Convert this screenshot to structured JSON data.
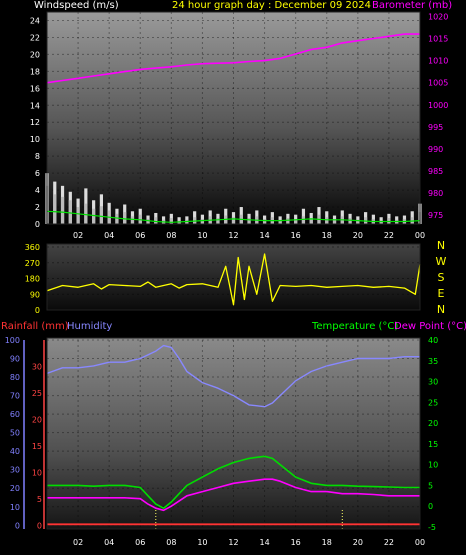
{
  "header": {
    "left_label": "Windspeed (m/s)",
    "title": "24 hour graph day : December 09 2024",
    "right_label": "Barometer (mb)"
  },
  "panel3_header": {
    "rain_label": "Rainfall (mm)",
    "humidity_label": "Humidity",
    "temp_label": "Temperature (°C)",
    "dew_label": "Dew Point (°C)"
  },
  "compass": [
    "N",
    "W",
    "S",
    "E",
    "N"
  ],
  "colors": {
    "wind": "#e0e0e0",
    "gust": "#ffffff",
    "wind_avg": "#00e000",
    "barometer": "#ff00ff",
    "direction": "#ffff00",
    "rain": "#ff3333",
    "humidity": "#8888ff",
    "temperature": "#00dd00",
    "dewpoint": "#ff00ff",
    "axis_left": "#ffffff",
    "header_title": "#ffff00",
    "rain_axis": "#ff4444",
    "humidity_axis": "#8080ff",
    "temp_axis": "#00ff00"
  },
  "chart_data": [
    {
      "type": "line",
      "title": "24 hour graph day : December 09 2024",
      "x_ticks": [
        "02",
        "04",
        "06",
        "08",
        "10",
        "12",
        "14",
        "16",
        "18",
        "20",
        "22",
        "00"
      ],
      "y_left": {
        "label": "Windspeed (m/s)",
        "ticks": [
          0,
          2,
          4,
          6,
          8,
          10,
          12,
          14,
          16,
          18,
          20,
          22,
          24
        ],
        "range": [
          0,
          25
        ]
      },
      "y_right": {
        "label": "Barometer (mb)",
        "ticks": [
          975,
          980,
          985,
          990,
          995,
          1000,
          1005,
          1010,
          1015,
          1020
        ],
        "range": [
          973,
          1021
        ]
      },
      "series": [
        {
          "name": "Barometer (mb)",
          "axis": "right",
          "x": [
            0,
            1,
            2,
            3,
            4,
            5,
            6,
            7,
            8,
            9,
            10,
            11,
            12,
            13,
            14,
            15,
            16,
            17,
            18,
            19,
            20,
            21,
            22,
            23,
            24
          ],
          "values": [
            1005,
            1005.5,
            1006,
            1006.5,
            1007,
            1007.5,
            1008,
            1008.3,
            1008.6,
            1009,
            1009.3,
            1009.4,
            1009.5,
            1009.8,
            1010,
            1010.5,
            1011.5,
            1012.5,
            1013,
            1014,
            1014.5,
            1015,
            1015.5,
            1016,
            1016
          ]
        },
        {
          "name": "Windspeed",
          "axis": "left",
          "x": [
            0,
            0.5,
            1,
            1.5,
            2,
            2.5,
            3,
            3.5,
            4,
            4.5,
            5,
            5.5,
            6,
            6.5,
            7,
            7.5,
            8,
            8.5,
            9,
            9.5,
            10,
            10.5,
            11,
            11.5,
            12,
            12.5,
            13,
            13.5,
            14,
            14.5,
            15,
            15.5,
            16,
            16.5,
            17,
            17.5,
            18,
            18.5,
            19,
            19.5,
            20,
            20.5,
            21,
            21.5,
            22,
            22.5,
            23,
            23.5,
            24
          ],
          "values": [
            4.5,
            3.5,
            3.2,
            2.8,
            2,
            2.4,
            1.8,
            2.1,
            1.6,
            1.2,
            1.4,
            0.9,
            1.1,
            0.6,
            0.8,
            0.5,
            0.7,
            0.4,
            0.5,
            0.8,
            0.6,
            0.9,
            0.7,
            1.0,
            0.8,
            1.1,
            0.7,
            0.9,
            0.6,
            0.8,
            0.5,
            0.7,
            0.6,
            0.9,
            0.7,
            1.1,
            0.8,
            0.6,
            0.9,
            0.7,
            0.5,
            0.8,
            0.6,
            0.4,
            0.7,
            0.5,
            0.6,
            0.8,
            1.4
          ]
        },
        {
          "name": "Gust",
          "axis": "left",
          "x": [
            0,
            0.5,
            1,
            1.5,
            2,
            2.5,
            3,
            3.5,
            4,
            4.5,
            5,
            5.5,
            6,
            6.5,
            7,
            7.5,
            8,
            8.5,
            9,
            9.5,
            10,
            10.5,
            11,
            11.5,
            12,
            12.5,
            13,
            13.5,
            14,
            14.5,
            15,
            15.5,
            16,
            16.5,
            17,
            17.5,
            18,
            18.5,
            19,
            19.5,
            20,
            20.5,
            21,
            21.5,
            22,
            22.5,
            23,
            23.5,
            24
          ],
          "values": [
            6,
            5,
            4.5,
            3.8,
            3,
            4.2,
            2.8,
            3.5,
            2.5,
            1.8,
            2.3,
            1.5,
            1.8,
            1.0,
            1.3,
            0.9,
            1.2,
            0.8,
            0.9,
            1.5,
            1.1,
            1.6,
            1.2,
            1.8,
            1.4,
            2.0,
            1.2,
            1.6,
            1.0,
            1.4,
            0.9,
            1.2,
            1.1,
            1.8,
            1.3,
            2.0,
            1.5,
            1.0,
            1.6,
            1.2,
            0.9,
            1.4,
            1.1,
            0.8,
            1.2,
            0.9,
            1.0,
            1.5,
            2.4
          ]
        },
        {
          "name": "Avg Wind",
          "axis": "left",
          "x": [
            0,
            1,
            2,
            3,
            4,
            5,
            6,
            7,
            8,
            9,
            10,
            11,
            12,
            13,
            14,
            15,
            16,
            17,
            18,
            19,
            20,
            21,
            22,
            23,
            24
          ],
          "values": [
            1.5,
            1.4,
            1.2,
            1.0,
            0.8,
            0.6,
            0.5,
            0.3,
            0.2,
            0.3,
            0.4,
            0.5,
            0.6,
            0.5,
            0.4,
            0.4,
            0.5,
            0.6,
            0.5,
            0.5,
            0.4,
            0.3,
            0.3,
            0.3,
            0.4
          ]
        }
      ]
    },
    {
      "type": "line",
      "x_ticks": [
        "02",
        "04",
        "06",
        "08",
        "10",
        "12",
        "14",
        "16",
        "18",
        "20",
        "22",
        "00"
      ],
      "y_left": {
        "ticks": [
          0,
          90,
          180,
          270,
          360
        ],
        "range": [
          0,
          360
        ]
      },
      "series": [
        {
          "name": "Wind Direction",
          "x": [
            0,
            1,
            2,
            3,
            3.5,
            4,
            5,
            6,
            6.5,
            7,
            8,
            8.5,
            9,
            10,
            11,
            11.5,
            12,
            12.3,
            12.7,
            13,
            13.5,
            14,
            14.5,
            15,
            16,
            17,
            18,
            19,
            20,
            21,
            22,
            23,
            23.7,
            24
          ],
          "values": [
            110,
            140,
            130,
            150,
            120,
            145,
            140,
            135,
            160,
            130,
            150,
            125,
            145,
            150,
            130,
            250,
            30,
            300,
            60,
            250,
            90,
            320,
            50,
            140,
            135,
            140,
            130,
            135,
            140,
            130,
            135,
            125,
            90,
            260
          ]
        }
      ]
    },
    {
      "type": "line",
      "x_ticks": [
        "02",
        "04",
        "06",
        "08",
        "10",
        "12",
        "14",
        "16",
        "18",
        "20",
        "22",
        "00"
      ],
      "y_left": {
        "label": "Humidity",
        "ticks": [
          0,
          10,
          20,
          30,
          40,
          50,
          60,
          70,
          80,
          90,
          100
        ],
        "range": [
          -2,
          100
        ]
      },
      "y_rain": {
        "label": "Rainfall (mm)",
        "ticks": [
          0,
          5,
          10,
          15,
          20,
          25,
          30
        ]
      },
      "y_right": {
        "label": "Temperature (°C)",
        "ticks": [
          -5,
          0,
          5,
          10,
          15,
          20,
          25,
          30,
          35,
          40
        ],
        "range": [
          -5.5,
          40
        ]
      },
      "series": [
        {
          "name": "Humidity",
          "axis": "left",
          "x": [
            0,
            1,
            2,
            3,
            4,
            5,
            6,
            7,
            7.5,
            8,
            8.5,
            9,
            10,
            11,
            12,
            13,
            14,
            14.5,
            15,
            16,
            17,
            18,
            19,
            20,
            21,
            22,
            23,
            24
          ],
          "values": [
            82,
            85,
            85,
            86,
            88,
            88,
            90,
            94,
            97,
            96,
            90,
            83,
            77,
            74,
            70,
            65,
            64,
            66,
            70,
            78,
            83,
            86,
            88,
            90,
            90,
            90,
            91,
            91
          ]
        },
        {
          "name": "Temperature (°C)",
          "axis": "right",
          "x": [
            0,
            1,
            2,
            3,
            4,
            5,
            6,
            6.5,
            7,
            7.5,
            8,
            8.5,
            9,
            10,
            11,
            12,
            13,
            14,
            14.5,
            15,
            16,
            17,
            18,
            19,
            20,
            21,
            22,
            23,
            24
          ],
          "values": [
            5,
            5,
            5,
            4.8,
            5,
            5,
            4.5,
            2.5,
            0.5,
            -0.5,
            1,
            3,
            5,
            7,
            9,
            10.5,
            11.5,
            12,
            11.5,
            10,
            7,
            5.5,
            5,
            5,
            4.8,
            4.7,
            4.6,
            4.5,
            4.5
          ]
        },
        {
          "name": "Dew Point (°C)",
          "axis": "right",
          "x": [
            0,
            1,
            2,
            3,
            4,
            5,
            6,
            6.5,
            7,
            7.5,
            8,
            9,
            10,
            11,
            12,
            13,
            14,
            14.5,
            15,
            16,
            17,
            18,
            19,
            20,
            21,
            22,
            23,
            24
          ],
          "values": [
            2,
            2,
            2,
            2,
            2,
            2,
            1.8,
            0.5,
            -0.5,
            -1,
            0,
            2.5,
            3.5,
            4.5,
            5.5,
            6,
            6.5,
            6.5,
            6,
            4.5,
            3.5,
            3.5,
            3,
            3,
            2.8,
            2.5,
            2.5,
            2.5
          ]
        },
        {
          "name": "Rainfall (mm)",
          "axis": "rain",
          "x": [
            0,
            24
          ],
          "values": [
            0,
            0
          ]
        }
      ]
    }
  ]
}
